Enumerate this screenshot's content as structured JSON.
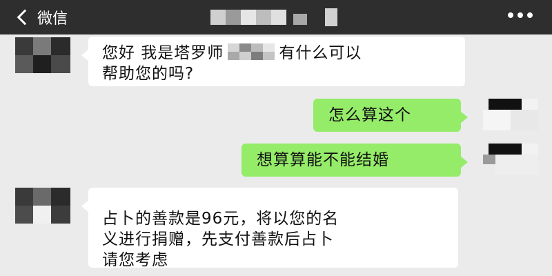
{
  "navbar": {
    "back_label": "微信",
    "back_icon": "chevron-left-icon",
    "more_icon": "more-dots-icon",
    "background": "#2e2e2e"
  },
  "messages": [
    {
      "side": "left",
      "text_before": "您好 我是塔罗师",
      "text_after": "有什么可以",
      "line2": "帮助您的吗?"
    },
    {
      "side": "right",
      "text": "怎么算这个"
    },
    {
      "side": "right",
      "text": "想算算能不能结婚"
    },
    {
      "side": "left",
      "lines": [
        "占卜的善款是96元，将以您的名",
        "义进行捐赠，先支付善款后占卜",
        "请您考虑"
      ]
    }
  ],
  "colors": {
    "background": "#ebebeb",
    "incoming_bubble": "#ffffff",
    "outgoing_bubble": "#95ec69"
  }
}
